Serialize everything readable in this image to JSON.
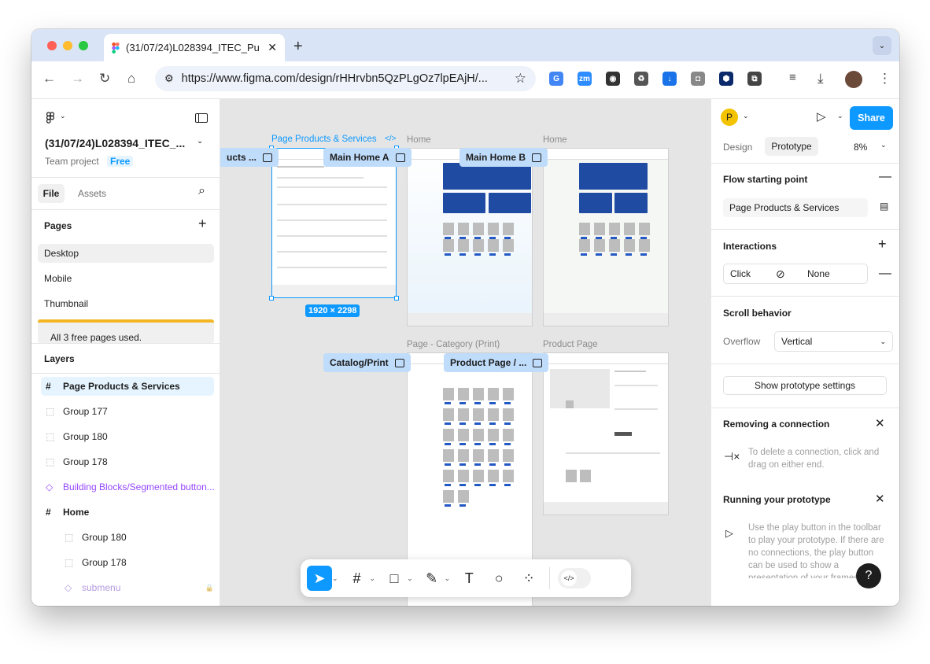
{
  "browser": {
    "tab_title": "(31/07/24)L028394_ITEC_Pu",
    "url": "https://www.figma.com/design/rHHrvbn5QzPLgOz7lpEAjH/...",
    "extensions": [
      {
        "name": "translate-icon",
        "color": "#4285f4",
        "glyph": "G"
      },
      {
        "name": "zoom-icon",
        "color": "#2d8cff",
        "glyph": "zm"
      },
      {
        "name": "record-icon",
        "color": "#333333",
        "glyph": "◉"
      },
      {
        "name": "recycle-icon",
        "color": "#555555",
        "glyph": "♻"
      },
      {
        "name": "download-arrow-icon",
        "color": "#1a73e8",
        "glyph": "↓"
      },
      {
        "name": "camera-icon",
        "color": "#888888",
        "glyph": "◘"
      },
      {
        "name": "hexagon-icon",
        "color": "#0b2a6b",
        "glyph": "⬢"
      },
      {
        "name": "puzzle-icon",
        "color": "#444444",
        "glyph": "⧉"
      }
    ]
  },
  "left_panel": {
    "file_name": "(31/07/24)L028394_ITEC_...",
    "team": "Team project",
    "plan": "Free",
    "tabs": {
      "file": "File",
      "assets": "Assets"
    },
    "pages_heading": "Pages",
    "pages": [
      "Desktop",
      "Mobile",
      "Thumbnail"
    ],
    "pages_notice": "All 3 free pages used.",
    "layers_heading": "Layers",
    "layers": [
      {
        "label": "Page Products & Services",
        "type": "frame",
        "indent": 0,
        "selected": true,
        "bold": true
      },
      {
        "label": "Group 177",
        "type": "group",
        "indent": 0
      },
      {
        "label": "Group 180",
        "type": "group",
        "indent": 0
      },
      {
        "label": "Group 178",
        "type": "group",
        "indent": 0
      },
      {
        "label": "Building Blocks/Segmented button...",
        "type": "component",
        "indent": 0
      },
      {
        "label": "Home",
        "type": "frame",
        "indent": 0,
        "bold": true
      },
      {
        "label": "Group 180",
        "type": "group",
        "indent": 1
      },
      {
        "label": "Group 178",
        "type": "group",
        "indent": 1
      },
      {
        "label": "submenu",
        "type": "component",
        "indent": 1,
        "muted": true
      }
    ]
  },
  "canvas": {
    "frames": {
      "products_title": "Page Products & Services",
      "home_left_title": "Home",
      "home_right_title": "Home",
      "category_title": "Page - Category (Print)",
      "product_title": "Product Page",
      "selection_size": "1920 × 2298"
    },
    "badges": {
      "cut_left": "ucts ...",
      "main_home_a": "Main Home A",
      "main_home_b": "Main Home B",
      "catalog": "Catalog/Print",
      "product_page": "Product Page / ..."
    }
  },
  "right_panel": {
    "avatar_letter": "P",
    "share": "Share",
    "tabs": {
      "design": "Design",
      "prototype": "Prototype"
    },
    "zoom": "8%",
    "flow_heading": "Flow starting point",
    "flow_value": "Page Products & Services",
    "interactions_heading": "Interactions",
    "interaction_trigger": "Click",
    "interaction_action": "None",
    "scroll_heading": "Scroll behavior",
    "overflow_label": "Overflow",
    "overflow_value": "Vertical",
    "show_settings": "Show prototype settings",
    "removing_heading": "Removing a connection",
    "removing_text": "To delete a connection, click and drag on either end.",
    "running_heading": "Running your prototype",
    "running_text": "Use the play button in the toolbar to play your prototype. If there are no connections, the play button can be used to show a presentation of your frames.",
    "help": "?"
  }
}
